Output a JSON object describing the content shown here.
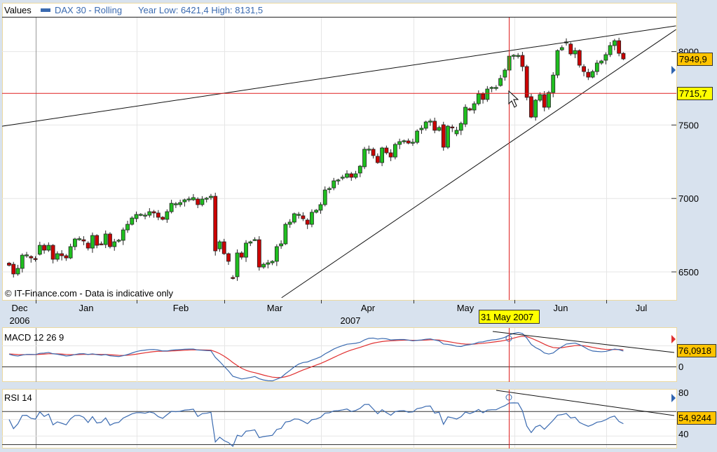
{
  "header": {
    "values_label": "Values",
    "series_name": "DAX 30 - Rolling",
    "year_range": "Year Low: 6421,4 High: 8131,5",
    "series_color": "#3a6ab0"
  },
  "footer_note": "© IT-Finance.com - Data is indicative only",
  "crosshair_date": "31 May 2007",
  "chart_data": [
    {
      "type": "candlestick",
      "title": "DAX 30 - Rolling",
      "x_months": [
        "Dec",
        "Jan",
        "Feb",
        "Mar",
        "Apr",
        "May",
        "Jun",
        "Jul"
      ],
      "x_years": [
        "2006",
        "2007"
      ],
      "y_ticks": [
        6500,
        7000,
        7500,
        8000
      ],
      "y_tick_labels": [
        "6500",
        "7000",
        "7500",
        "8000"
      ],
      "ylim": [
        6335,
        8330
      ],
      "last_value_label": "7949,9",
      "crosshair_value_label": "7715,7",
      "crosshair_value": 7715.7,
      "crosshair_index": 114,
      "up_color": "#1fbf1f",
      "down_color": "#cc0000",
      "trendlines": [
        {
          "from": [
            -1.6,
            7492
          ],
          "to": [
            152,
            8175
          ]
        },
        {
          "from": [
            62.1,
            6324
          ],
          "to": [
            152,
            8150
          ]
        }
      ],
      "oc": [
        [
          6560,
          6545
        ],
        [
          6552,
          6486
        ],
        [
          6486,
          6524
        ],
        [
          6524,
          6614
        ],
        [
          6612,
          6616
        ],
        [
          6605,
          6595
        ],
        [
          6591,
          6590
        ],
        [
          6620,
          6681
        ],
        [
          6681,
          6648
        ],
        [
          6648,
          6681
        ],
        [
          6681,
          6586
        ],
        [
          6586,
          6624
        ],
        [
          6624,
          6610
        ],
        [
          6610,
          6595
        ],
        [
          6595,
          6672
        ],
        [
          6672,
          6724
        ],
        [
          6724,
          6726
        ],
        [
          6719,
          6710
        ],
        [
          6696,
          6662
        ],
        [
          6662,
          6748
        ],
        [
          6748,
          6681
        ],
        [
          6691,
          6690
        ],
        [
          6686,
          6758
        ],
        [
          6758,
          6672
        ],
        [
          6672,
          6705
        ],
        [
          6715,
          6716
        ],
        [
          6715,
          6786
        ],
        [
          6786,
          6824
        ],
        [
          6824,
          6867
        ],
        [
          6863,
          6891
        ],
        [
          6891,
          6892
        ],
        [
          6886,
          6887
        ],
        [
          6886,
          6910
        ],
        [
          6910,
          6901
        ],
        [
          6901,
          6872
        ],
        [
          6872,
          6858
        ],
        [
          6858,
          6910
        ],
        [
          6910,
          6967
        ],
        [
          6963,
          6964
        ],
        [
          6958,
          6972
        ],
        [
          6977,
          6991
        ],
        [
          6996,
          6997
        ],
        [
          6991,
          7006
        ],
        [
          6996,
          6958
        ],
        [
          6958,
          6996
        ],
        [
          7001,
          7002
        ],
        [
          7006,
          7015
        ],
        [
          7015,
          6643
        ],
        [
          6657,
          6705
        ],
        [
          6705,
          6624
        ],
        [
          6624,
          6572
        ],
        [
          6462,
          6460
        ],
        [
          6467,
          6629
        ],
        [
          6629,
          6600
        ],
        [
          6600,
          6696
        ],
        [
          6696,
          6705
        ],
        [
          6719,
          6720
        ],
        [
          6719,
          6533
        ],
        [
          6533,
          6552
        ],
        [
          6552,
          6562
        ],
        [
          6562,
          6572
        ],
        [
          6572,
          6672
        ],
        [
          6677,
          6691
        ],
        [
          6691,
          6824
        ],
        [
          6824,
          6839
        ],
        [
          6839,
          6896
        ],
        [
          6891,
          6892
        ],
        [
          6882,
          6862
        ],
        [
          6853,
          6824
        ],
        [
          6824,
          6906
        ],
        [
          6906,
          6920
        ],
        [
          6920,
          6958
        ],
        [
          6958,
          7058
        ],
        [
          7063,
          7068
        ],
        [
          7072,
          7120
        ],
        [
          7125,
          7126
        ],
        [
          7144,
          7145
        ],
        [
          7144,
          7168
        ],
        [
          7168,
          7144
        ],
        [
          7144,
          7168
        ],
        [
          7173,
          7220
        ],
        [
          7216,
          7335
        ],
        [
          7335,
          7336
        ],
        [
          7335,
          7292
        ],
        [
          7287,
          7244
        ],
        [
          7244,
          7344
        ],
        [
          7344,
          7311
        ],
        [
          7311,
          7282
        ],
        [
          7282,
          7368
        ],
        [
          7368,
          7387
        ],
        [
          7392,
          7393
        ],
        [
          7392,
          7377
        ],
        [
          7382,
          7383
        ],
        [
          7382,
          7459
        ],
        [
          7468,
          7478
        ],
        [
          7478,
          7521
        ],
        [
          7526,
          7527
        ],
        [
          7526,
          7464
        ],
        [
          7464,
          7483
        ],
        [
          7502,
          7349
        ],
        [
          7349,
          7492
        ],
        [
          7487,
          7480
        ],
        [
          7440,
          7464
        ],
        [
          7464,
          7511
        ],
        [
          7506,
          7621
        ],
        [
          7611,
          7602
        ],
        [
          7602,
          7645
        ],
        [
          7645,
          7712
        ],
        [
          7712,
          7674
        ],
        [
          7674,
          7745
        ],
        [
          7755,
          7756
        ],
        [
          7755,
          7756
        ],
        [
          7769,
          7817
        ],
        [
          7826,
          7874
        ],
        [
          7874,
          7969
        ],
        [
          7974,
          7975
        ],
        [
          7969,
          7974
        ],
        [
          7974,
          7898
        ],
        [
          7898,
          7688
        ],
        [
          7693,
          7554
        ],
        [
          7554,
          7669
        ],
        [
          7669,
          7707
        ],
        [
          7707,
          7621
        ],
        [
          7621,
          7721
        ],
        [
          7721,
          7840
        ],
        [
          7840,
          8007
        ],
        [
          8012,
          8027
        ],
        [
          8065,
          8066
        ],
        [
          8051,
          7984
        ],
        [
          7984,
          8007
        ],
        [
          8007,
          7907
        ],
        [
          7898,
          7864
        ],
        [
          7859,
          7826
        ],
        [
          7826,
          7864
        ],
        [
          7864,
          7922
        ],
        [
          7922,
          7936
        ],
        [
          7941,
          7979
        ],
        [
          7979,
          8041
        ],
        [
          8041,
          8074
        ],
        [
          8074,
          7988
        ],
        [
          7988,
          7950
        ]
      ]
    },
    {
      "type": "line",
      "title": "MACD 12 26 9",
      "series": [
        {
          "name": "MACD",
          "color": "#3a6ab0"
        },
        {
          "name": "Signal",
          "color": "#e03030"
        }
      ],
      "y_tick_labels": [
        "0"
      ],
      "last_value_label": "76,0918"
    },
    {
      "type": "line",
      "title": "RSI 14",
      "series": [
        {
          "name": "RSI",
          "color": "#3a6ab0"
        }
      ],
      "y_tick_labels": [
        "80",
        "40"
      ],
      "levels": [
        70,
        30
      ],
      "last_value_label": "54,9244"
    }
  ]
}
